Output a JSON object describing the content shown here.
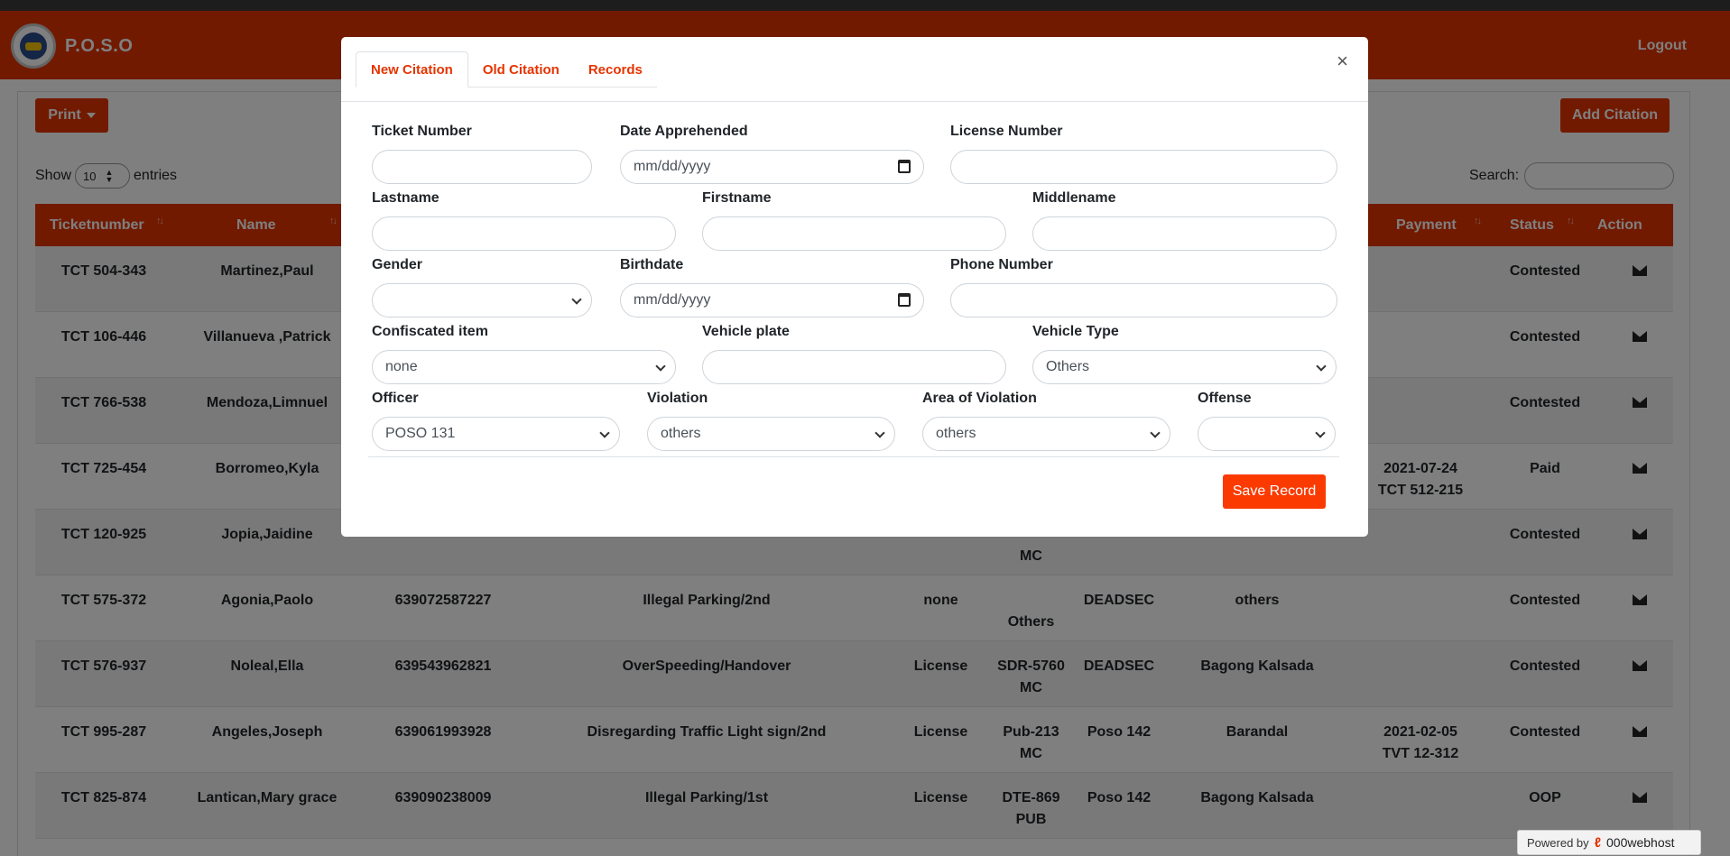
{
  "navbar": {
    "brand": "P.O.S.O",
    "logout": "Logout"
  },
  "toolbar": {
    "print": "Print",
    "add_citation": "Add Citation"
  },
  "length": {
    "show": "Show",
    "value": "10",
    "entries": "entries"
  },
  "search": {
    "label": "Search:"
  },
  "table": {
    "headers": [
      "Ticketnumber",
      "Name",
      "Payment",
      "Status",
      "Action"
    ],
    "rows": [
      {
        "ticket": "TCT 504-343",
        "name": "Martinez,Paul",
        "phone": "",
        "violation": "",
        "confiscated": "",
        "plate": "",
        "plate2": "",
        "officer": "",
        "area": "",
        "payment": "",
        "payment2": "",
        "status": "Contested"
      },
      {
        "ticket": "TCT 106-446",
        "name": "Villanueva ,Patrick",
        "phone": "",
        "violation": "",
        "confiscated": "",
        "plate": "",
        "plate2": "",
        "officer": "",
        "area": "",
        "payment": "",
        "payment2": "",
        "status": "Contested"
      },
      {
        "ticket": "TCT 766-538",
        "name": "Mendoza,Limnuel",
        "phone": "",
        "violation": "",
        "confiscated": "",
        "plate": "",
        "plate2": "",
        "officer": "",
        "area": "",
        "payment": "",
        "payment2": "",
        "status": "Contested"
      },
      {
        "ticket": "TCT 725-454",
        "name": "Borromeo,Kyla",
        "phone": "",
        "violation": "",
        "confiscated": "",
        "plate": "",
        "plate2": "",
        "officer": "",
        "area": "",
        "payment": "2021-07-24",
        "payment2": "TCT 512-215",
        "status": "Paid"
      },
      {
        "ticket": "TCT 120-925",
        "name": "Jopia,Jaidine",
        "phone": "",
        "violation": "",
        "confiscated": "",
        "plate": "",
        "plate2": "MC",
        "officer": "",
        "area": "",
        "payment": "",
        "payment2": "",
        "status": "Contested"
      },
      {
        "ticket": "TCT 575-372",
        "name": "Agonia,Paolo",
        "phone": "639072587227",
        "violation": "Illegal Parking/2nd",
        "confiscated": "none",
        "plate": "",
        "plate2": "Others",
        "officer": "DEADSEC",
        "area": "others",
        "payment": "",
        "payment2": "",
        "status": "Contested"
      },
      {
        "ticket": "TCT 576-937",
        "name": "Noleal,Ella",
        "phone": "639543962821",
        "violation": "OverSpeeding/Handover",
        "confiscated": "License",
        "plate": "SDR-5760",
        "plate2": "MC",
        "officer": "DEADSEC",
        "area": "Bagong Kalsada",
        "payment": "",
        "payment2": "",
        "status": "Contested"
      },
      {
        "ticket": "TCT 995-287",
        "name": "Angeles,Joseph",
        "phone": "639061993928",
        "violation": "Disregarding Traffic Light sign/2nd",
        "confiscated": "License",
        "plate": "Pub-213",
        "plate2": "MC",
        "officer": "Poso 142",
        "area": "Barandal",
        "payment": "2021-02-05",
        "payment2": "TVT 12-312",
        "status": "Contested"
      },
      {
        "ticket": "TCT 825-874",
        "name": "Lantican,Mary grace",
        "phone": "639090238009",
        "violation": "Illegal Parking/1st",
        "confiscated": "License",
        "plate": "DTE-869",
        "plate2": "PUB",
        "officer": "Poso 142",
        "area": "Bagong Kalsada",
        "payment": "",
        "payment2": "",
        "status": "OOP"
      }
    ]
  },
  "modal": {
    "tabs": [
      "New Citation",
      "Old Citation",
      "Records"
    ],
    "close": "×",
    "labels": {
      "ticket_number": "Ticket Number",
      "date_apprehended": "Date Apprehended",
      "license_number": "License Number",
      "lastname": "Lastname",
      "firstname": "Firstname",
      "middlename": "Middlename",
      "gender": "Gender",
      "birthdate": "Birthdate",
      "phone_number": "Phone Number",
      "confiscated_item": "Confiscated item",
      "vehicle_plate": "Vehicle plate",
      "vehicle_type": "Vehicle Type",
      "officer": "Officer",
      "violation": "Violation",
      "area_of_violation": "Area of Violation",
      "offense": "Offense"
    },
    "values": {
      "date_placeholder": "mm/dd/yyyy",
      "birthdate_placeholder": "mm/dd/yyyy",
      "confiscated_item": "none",
      "vehicle_type": "Others",
      "officer": "POSO 131",
      "violation": "others",
      "area_of_violation": "others"
    },
    "save": "Save Record"
  },
  "footer": {
    "powered": "Powered by",
    "host": "000webhost"
  },
  "colors": {
    "accent": "#e53400",
    "save": "#fa3a00"
  }
}
